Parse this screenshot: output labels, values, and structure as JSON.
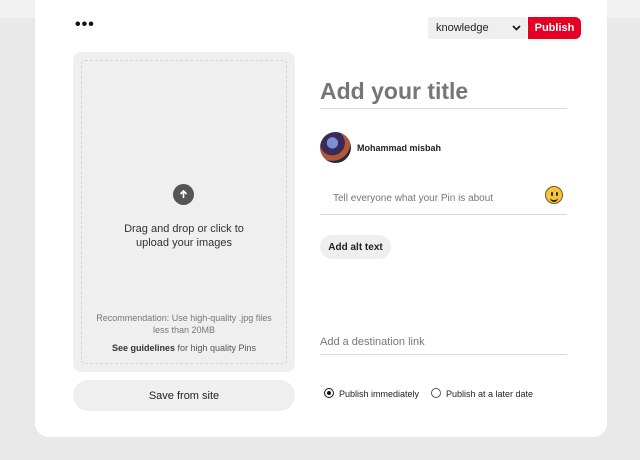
{
  "header": {
    "more_label": "•••",
    "board_select": {
      "value": "knowledge"
    },
    "publish_label": "Publish"
  },
  "upload": {
    "instruction_line1": "Drag and drop or click to",
    "instruction_line2": "upload your images",
    "recommendation_line1": "Recommendation: Use high-quality .jpg files",
    "recommendation_line2": "less than 20MB",
    "guidelines_link": "See guidelines",
    "guidelines_rest": " for high quality Pins",
    "save_from_site_label": "Save from site"
  },
  "form": {
    "title_placeholder": "Add your title",
    "user_name": "Mohammad misbah",
    "description_placeholder": "Tell everyone what your Pin is about",
    "alt_text_label": "Add alt text",
    "destination_placeholder": "Add a destination link",
    "publish_options": [
      {
        "label": "Publish immediately",
        "checked": true
      },
      {
        "label": "Publish at a later date",
        "checked": false
      }
    ]
  },
  "colors": {
    "accent": "#e60023",
    "background": "#e9e9e9",
    "card": "#ffffff"
  }
}
